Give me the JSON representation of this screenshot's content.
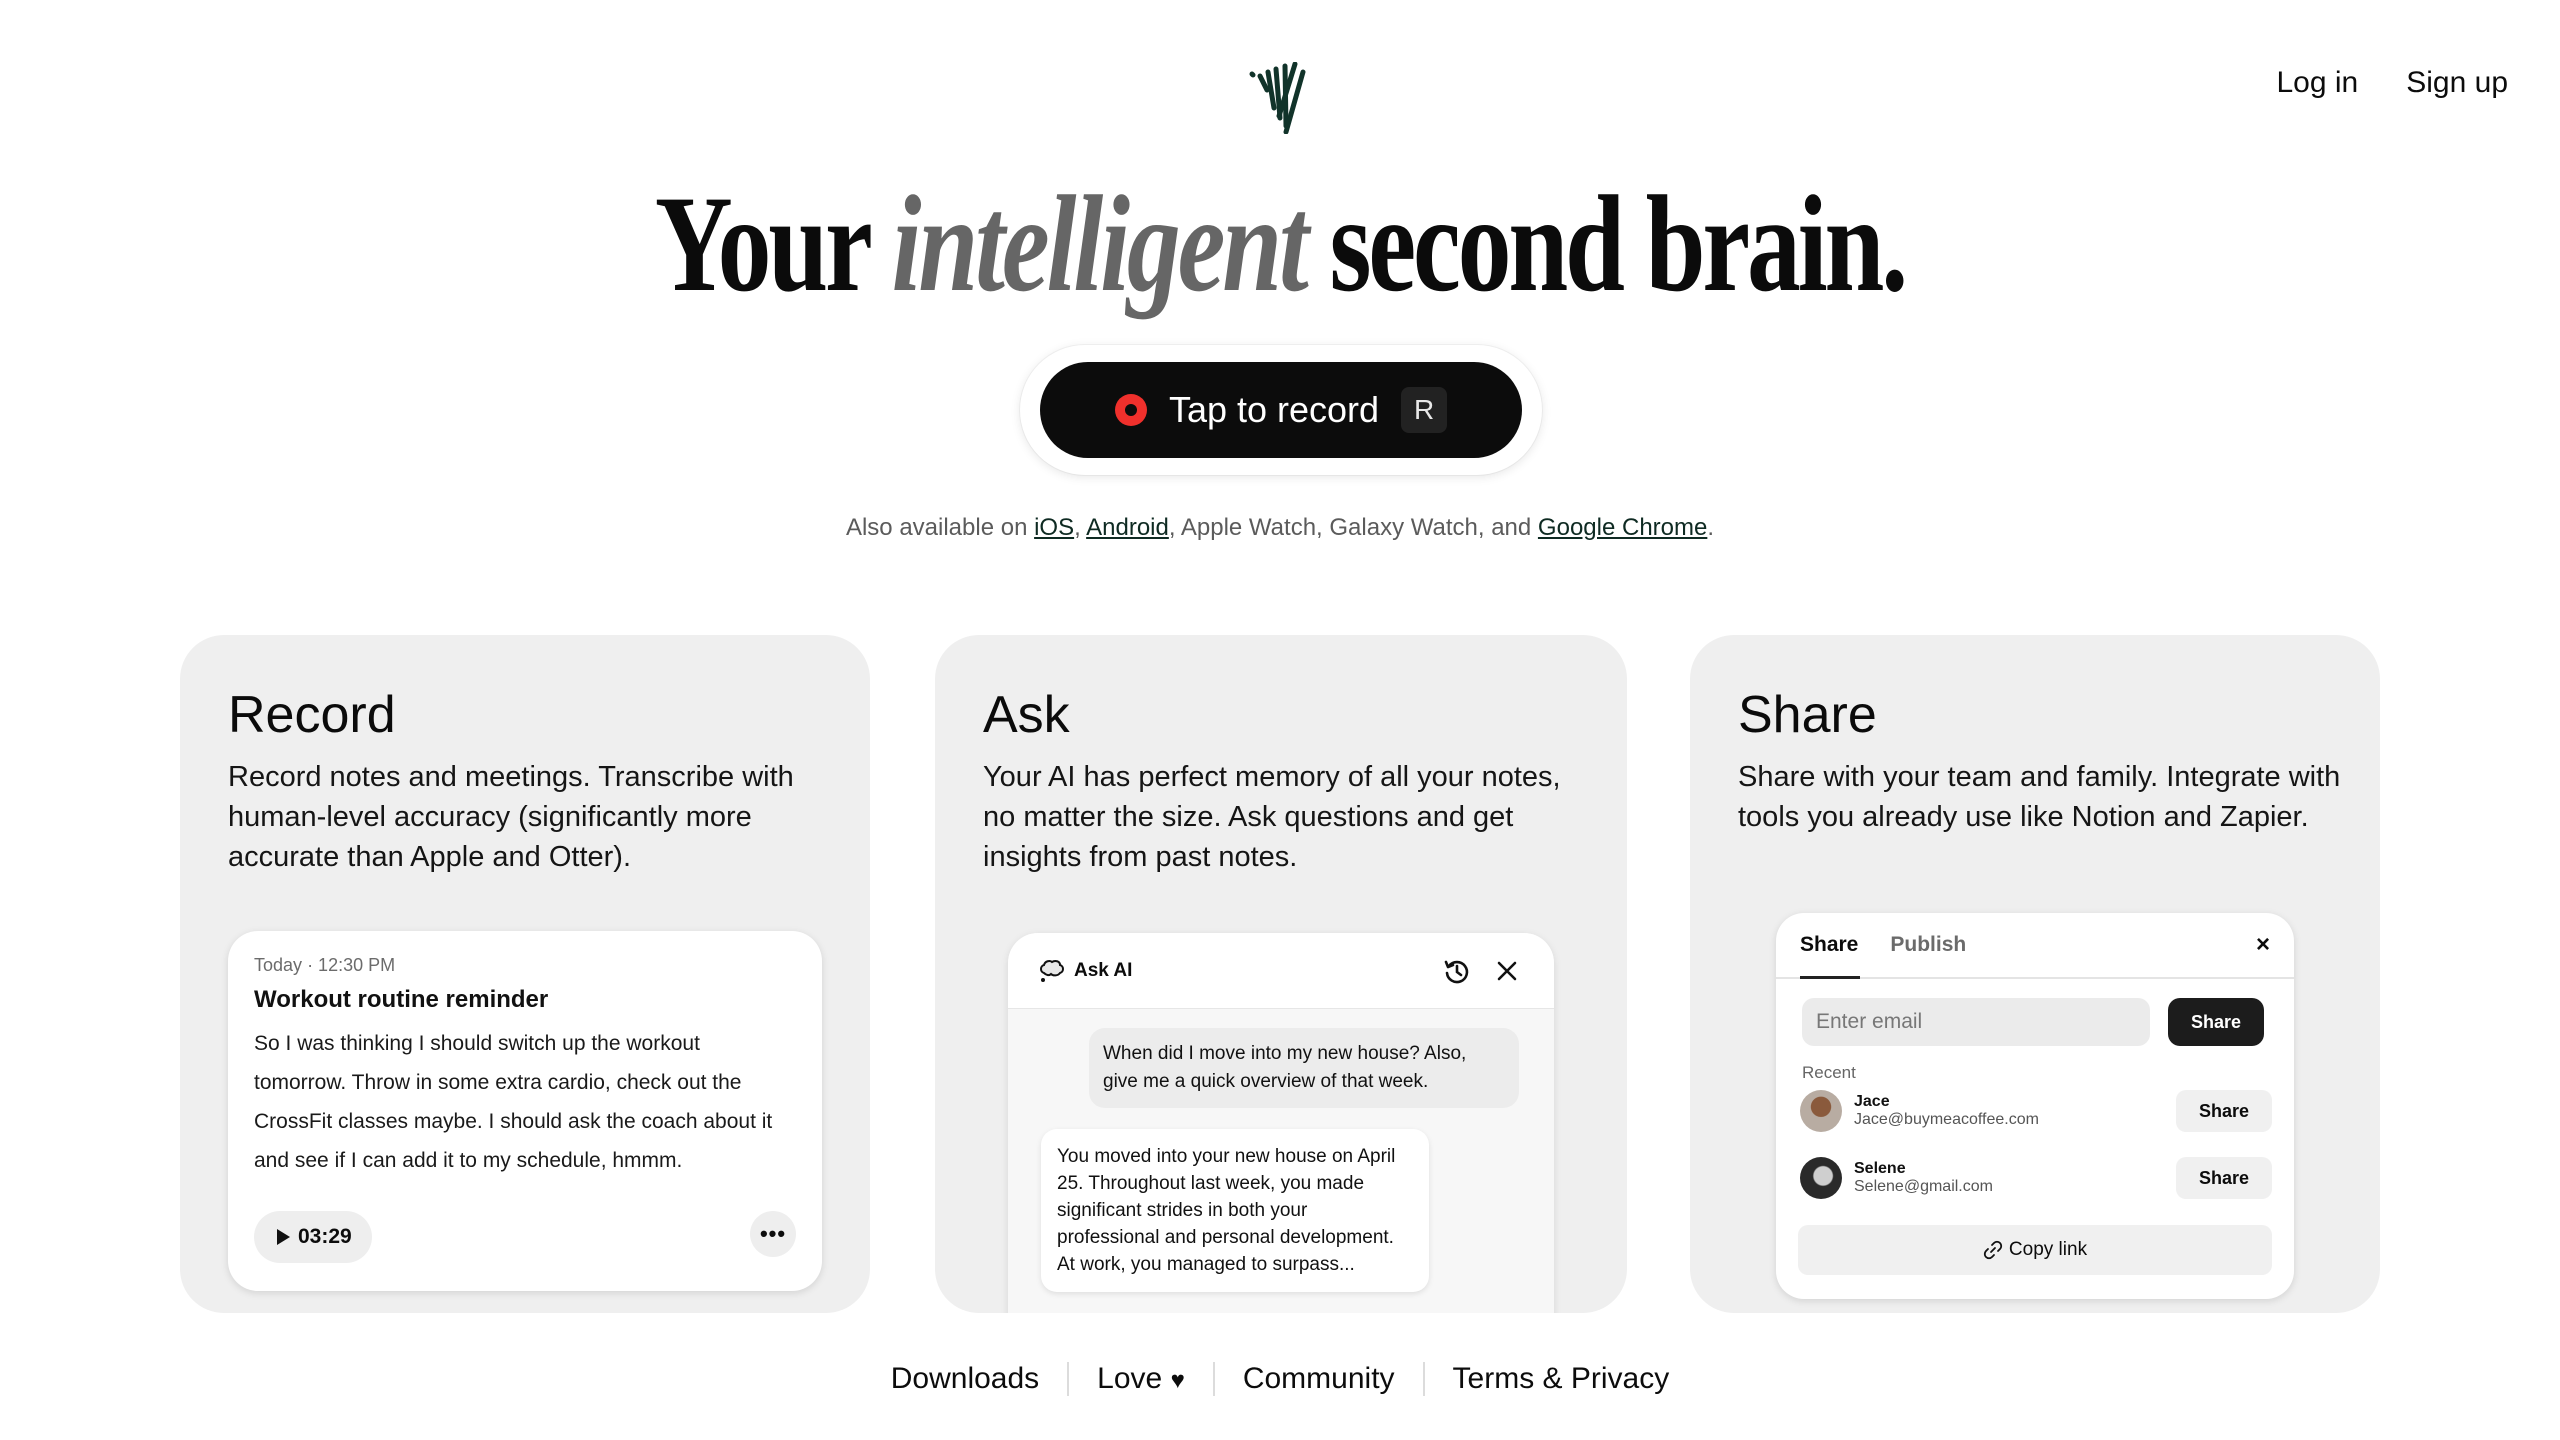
{
  "nav": {
    "login": "Log in",
    "signup": "Sign up"
  },
  "logo": {
    "icon": "waveform-heart-logo",
    "color": "#11332a"
  },
  "hero": {
    "title_before": "Your",
    "title_em": "intelligent",
    "title_after": "second brain.",
    "record_label": "Tap to record",
    "record_shortcut": "R",
    "record_color": "#f0302c",
    "avail_prefix": "Also available on ",
    "avail_ios": "iOS",
    "avail_sep1": ", ",
    "avail_android": "Android",
    "avail_mid": ", Apple Watch, Galaxy Watch, and ",
    "avail_chrome": "Google Chrome",
    "avail_end": "."
  },
  "cards": {
    "record": {
      "title": "Record",
      "desc": "Record notes and meetings. Transcribe with human-level accuracy (significantly more accurate than Apple and Otter).",
      "note": {
        "date": "Today",
        "time": "· 12:30 PM",
        "title": "Workout routine reminder",
        "body": "So I was thinking I should switch up the workout tomorrow. Throw in some extra cardio, check out the CrossFit classes maybe. I should ask the coach about it and see if I can add it to my schedule, hmmm.",
        "duration": "03:29",
        "more": "•••"
      }
    },
    "ask": {
      "title": "Ask",
      "desc": "Your AI has perfect memory of all your notes, no matter the size. Ask questions and get insights from past notes.",
      "panel_title": "Ask AI",
      "question": "When did I move into my new house? Also, give me a quick overview of that week.",
      "answer": "You moved into your new house on April 25. Throughout last week, you made significant strides in both your professional and personal development. At work, you managed to surpass..."
    },
    "share": {
      "title": "Share",
      "desc": "Share with your team and family. Integrate with tools you already use like Notion and Zapier.",
      "tab_share": "Share",
      "tab_publish": "Publish",
      "close": "×",
      "email_placeholder": "Enter email",
      "share_button": "Share",
      "recent_label": "Recent",
      "people": [
        {
          "name": "Jace",
          "email": "Jace@buymeacoffee.com",
          "button": "Share"
        },
        {
          "name": "Selene",
          "email": "Selene@gmail.com",
          "button": "Share"
        }
      ],
      "copy_link": "Copy link"
    }
  },
  "footer": {
    "downloads": "Downloads",
    "love": "Love",
    "community": "Community",
    "terms": "Terms & Privacy"
  }
}
